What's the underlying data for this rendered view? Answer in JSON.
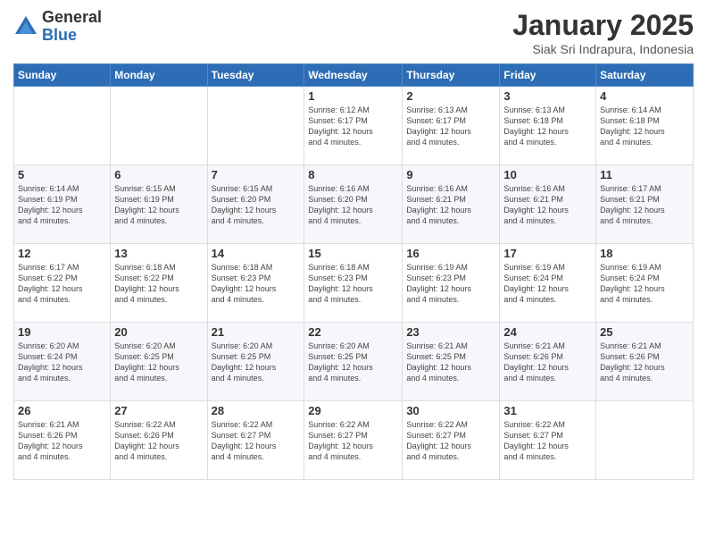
{
  "logo": {
    "general": "General",
    "blue": "Blue"
  },
  "header": {
    "title": "January 2025",
    "subtitle": "Siak Sri Indrapura, Indonesia"
  },
  "weekdays": [
    "Sunday",
    "Monday",
    "Tuesday",
    "Wednesday",
    "Thursday",
    "Friday",
    "Saturday"
  ],
  "weeks": [
    [
      {
        "day": "",
        "info": ""
      },
      {
        "day": "",
        "info": ""
      },
      {
        "day": "",
        "info": ""
      },
      {
        "day": "1",
        "info": "Sunrise: 6:12 AM\nSunset: 6:17 PM\nDaylight: 12 hours\nand 4 minutes."
      },
      {
        "day": "2",
        "info": "Sunrise: 6:13 AM\nSunset: 6:17 PM\nDaylight: 12 hours\nand 4 minutes."
      },
      {
        "day": "3",
        "info": "Sunrise: 6:13 AM\nSunset: 6:18 PM\nDaylight: 12 hours\nand 4 minutes."
      },
      {
        "day": "4",
        "info": "Sunrise: 6:14 AM\nSunset: 6:18 PM\nDaylight: 12 hours\nand 4 minutes."
      }
    ],
    [
      {
        "day": "5",
        "info": "Sunrise: 6:14 AM\nSunset: 6:19 PM\nDaylight: 12 hours\nand 4 minutes."
      },
      {
        "day": "6",
        "info": "Sunrise: 6:15 AM\nSunset: 6:19 PM\nDaylight: 12 hours\nand 4 minutes."
      },
      {
        "day": "7",
        "info": "Sunrise: 6:15 AM\nSunset: 6:20 PM\nDaylight: 12 hours\nand 4 minutes."
      },
      {
        "day": "8",
        "info": "Sunrise: 6:16 AM\nSunset: 6:20 PM\nDaylight: 12 hours\nand 4 minutes."
      },
      {
        "day": "9",
        "info": "Sunrise: 6:16 AM\nSunset: 6:21 PM\nDaylight: 12 hours\nand 4 minutes."
      },
      {
        "day": "10",
        "info": "Sunrise: 6:16 AM\nSunset: 6:21 PM\nDaylight: 12 hours\nand 4 minutes."
      },
      {
        "day": "11",
        "info": "Sunrise: 6:17 AM\nSunset: 6:21 PM\nDaylight: 12 hours\nand 4 minutes."
      }
    ],
    [
      {
        "day": "12",
        "info": "Sunrise: 6:17 AM\nSunset: 6:22 PM\nDaylight: 12 hours\nand 4 minutes."
      },
      {
        "day": "13",
        "info": "Sunrise: 6:18 AM\nSunset: 6:22 PM\nDaylight: 12 hours\nand 4 minutes."
      },
      {
        "day": "14",
        "info": "Sunrise: 6:18 AM\nSunset: 6:23 PM\nDaylight: 12 hours\nand 4 minutes."
      },
      {
        "day": "15",
        "info": "Sunrise: 6:18 AM\nSunset: 6:23 PM\nDaylight: 12 hours\nand 4 minutes."
      },
      {
        "day": "16",
        "info": "Sunrise: 6:19 AM\nSunset: 6:23 PM\nDaylight: 12 hours\nand 4 minutes."
      },
      {
        "day": "17",
        "info": "Sunrise: 6:19 AM\nSunset: 6:24 PM\nDaylight: 12 hours\nand 4 minutes."
      },
      {
        "day": "18",
        "info": "Sunrise: 6:19 AM\nSunset: 6:24 PM\nDaylight: 12 hours\nand 4 minutes."
      }
    ],
    [
      {
        "day": "19",
        "info": "Sunrise: 6:20 AM\nSunset: 6:24 PM\nDaylight: 12 hours\nand 4 minutes."
      },
      {
        "day": "20",
        "info": "Sunrise: 6:20 AM\nSunset: 6:25 PM\nDaylight: 12 hours\nand 4 minutes."
      },
      {
        "day": "21",
        "info": "Sunrise: 6:20 AM\nSunset: 6:25 PM\nDaylight: 12 hours\nand 4 minutes."
      },
      {
        "day": "22",
        "info": "Sunrise: 6:20 AM\nSunset: 6:25 PM\nDaylight: 12 hours\nand 4 minutes."
      },
      {
        "day": "23",
        "info": "Sunrise: 6:21 AM\nSunset: 6:25 PM\nDaylight: 12 hours\nand 4 minutes."
      },
      {
        "day": "24",
        "info": "Sunrise: 6:21 AM\nSunset: 6:26 PM\nDaylight: 12 hours\nand 4 minutes."
      },
      {
        "day": "25",
        "info": "Sunrise: 6:21 AM\nSunset: 6:26 PM\nDaylight: 12 hours\nand 4 minutes."
      }
    ],
    [
      {
        "day": "26",
        "info": "Sunrise: 6:21 AM\nSunset: 6:26 PM\nDaylight: 12 hours\nand 4 minutes."
      },
      {
        "day": "27",
        "info": "Sunrise: 6:22 AM\nSunset: 6:26 PM\nDaylight: 12 hours\nand 4 minutes."
      },
      {
        "day": "28",
        "info": "Sunrise: 6:22 AM\nSunset: 6:27 PM\nDaylight: 12 hours\nand 4 minutes."
      },
      {
        "day": "29",
        "info": "Sunrise: 6:22 AM\nSunset: 6:27 PM\nDaylight: 12 hours\nand 4 minutes."
      },
      {
        "day": "30",
        "info": "Sunrise: 6:22 AM\nSunset: 6:27 PM\nDaylight: 12 hours\nand 4 minutes."
      },
      {
        "day": "31",
        "info": "Sunrise: 6:22 AM\nSunset: 6:27 PM\nDaylight: 12 hours\nand 4 minutes."
      },
      {
        "day": "",
        "info": ""
      }
    ]
  ]
}
